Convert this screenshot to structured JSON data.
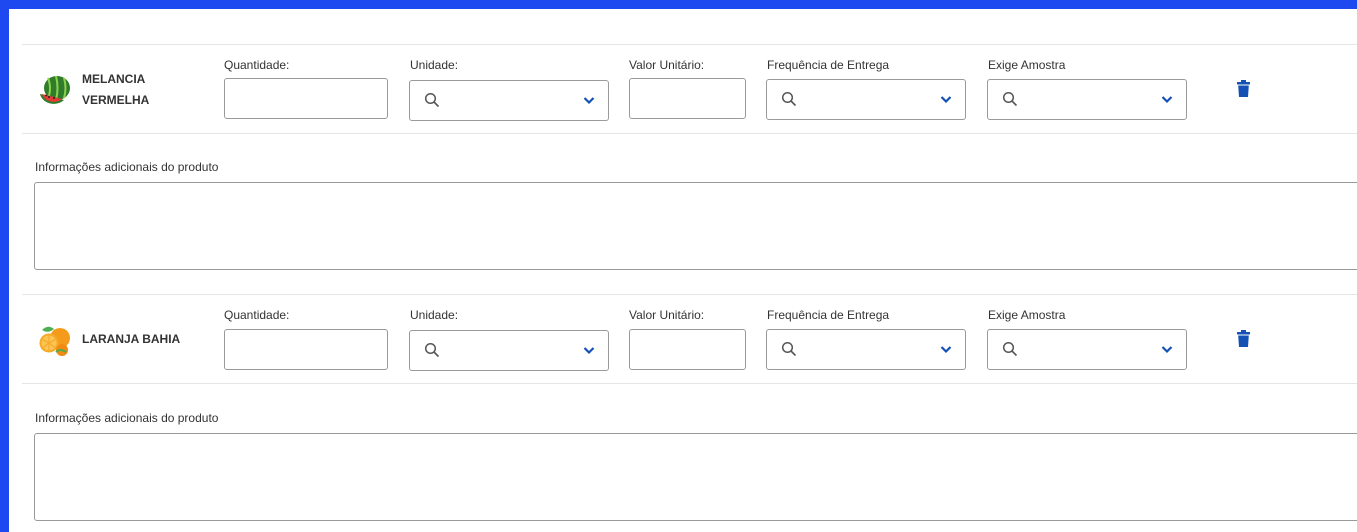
{
  "field_labels": {
    "quantidade": "Quantidade:",
    "unidade": "Unidade:",
    "valor_unitario": "Valor Unitário:",
    "frequencia": "Frequência de Entrega",
    "exige_amostra": "Exige Amostra"
  },
  "info_label": "Informações adicionais do produto",
  "products": [
    {
      "name_line1": "MELANCIA",
      "name_line2": "VERMELHA",
      "icon": "watermelon-icon",
      "quantidade_value": "",
      "valor_unitario_value": "",
      "informacoes_value": ""
    },
    {
      "name_line1": "LARANJA BAHIA",
      "name_line2": "",
      "icon": "orange-icon",
      "quantidade_value": "",
      "valor_unitario_value": "",
      "informacoes_value": ""
    }
  ],
  "icons": {
    "search": "search-icon",
    "dropdown": "chevron-down-icon",
    "delete": "trash-icon"
  },
  "colors": {
    "frame": "#1e49f0",
    "border": "#9a9a9a",
    "accent": "#1351b4",
    "divider": "#e6e6e6"
  }
}
